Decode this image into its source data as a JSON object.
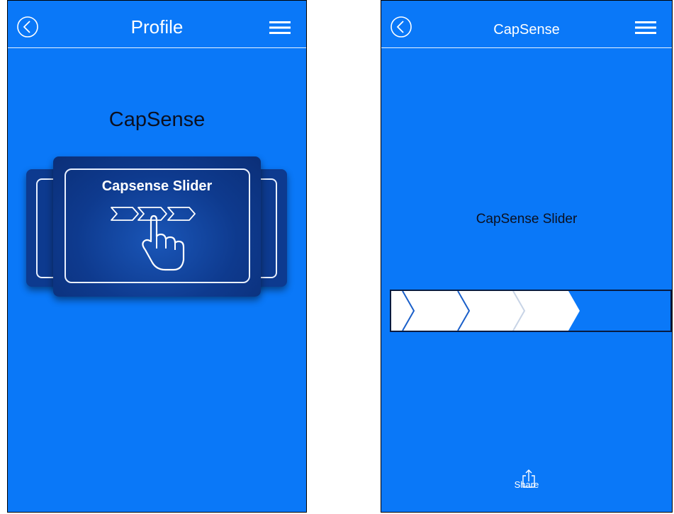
{
  "screens": [
    {
      "header": {
        "title": "Profile",
        "back_icon": "chevron-left-circle-icon",
        "menu_icon": "hamburger-menu-icon"
      },
      "section_title": "CapSense",
      "carousel": {
        "selected_card": {
          "title": "Capsense Slider",
          "icon": "slider-touch-icon"
        }
      }
    },
    {
      "header": {
        "title": "CapSense",
        "back_icon": "chevron-left-circle-icon",
        "menu_icon": "hamburger-menu-icon"
      },
      "section_title": "CapSense Slider",
      "slider": {
        "segments_total": 5,
        "segments_filled": 4
      },
      "footer": {
        "share_label": "Share",
        "share_icon": "share-icon"
      }
    }
  ],
  "colors": {
    "background": "#0a78f8",
    "card": "#0d3a8f",
    "text_dark": "#0b1020",
    "white": "#ffffff"
  }
}
